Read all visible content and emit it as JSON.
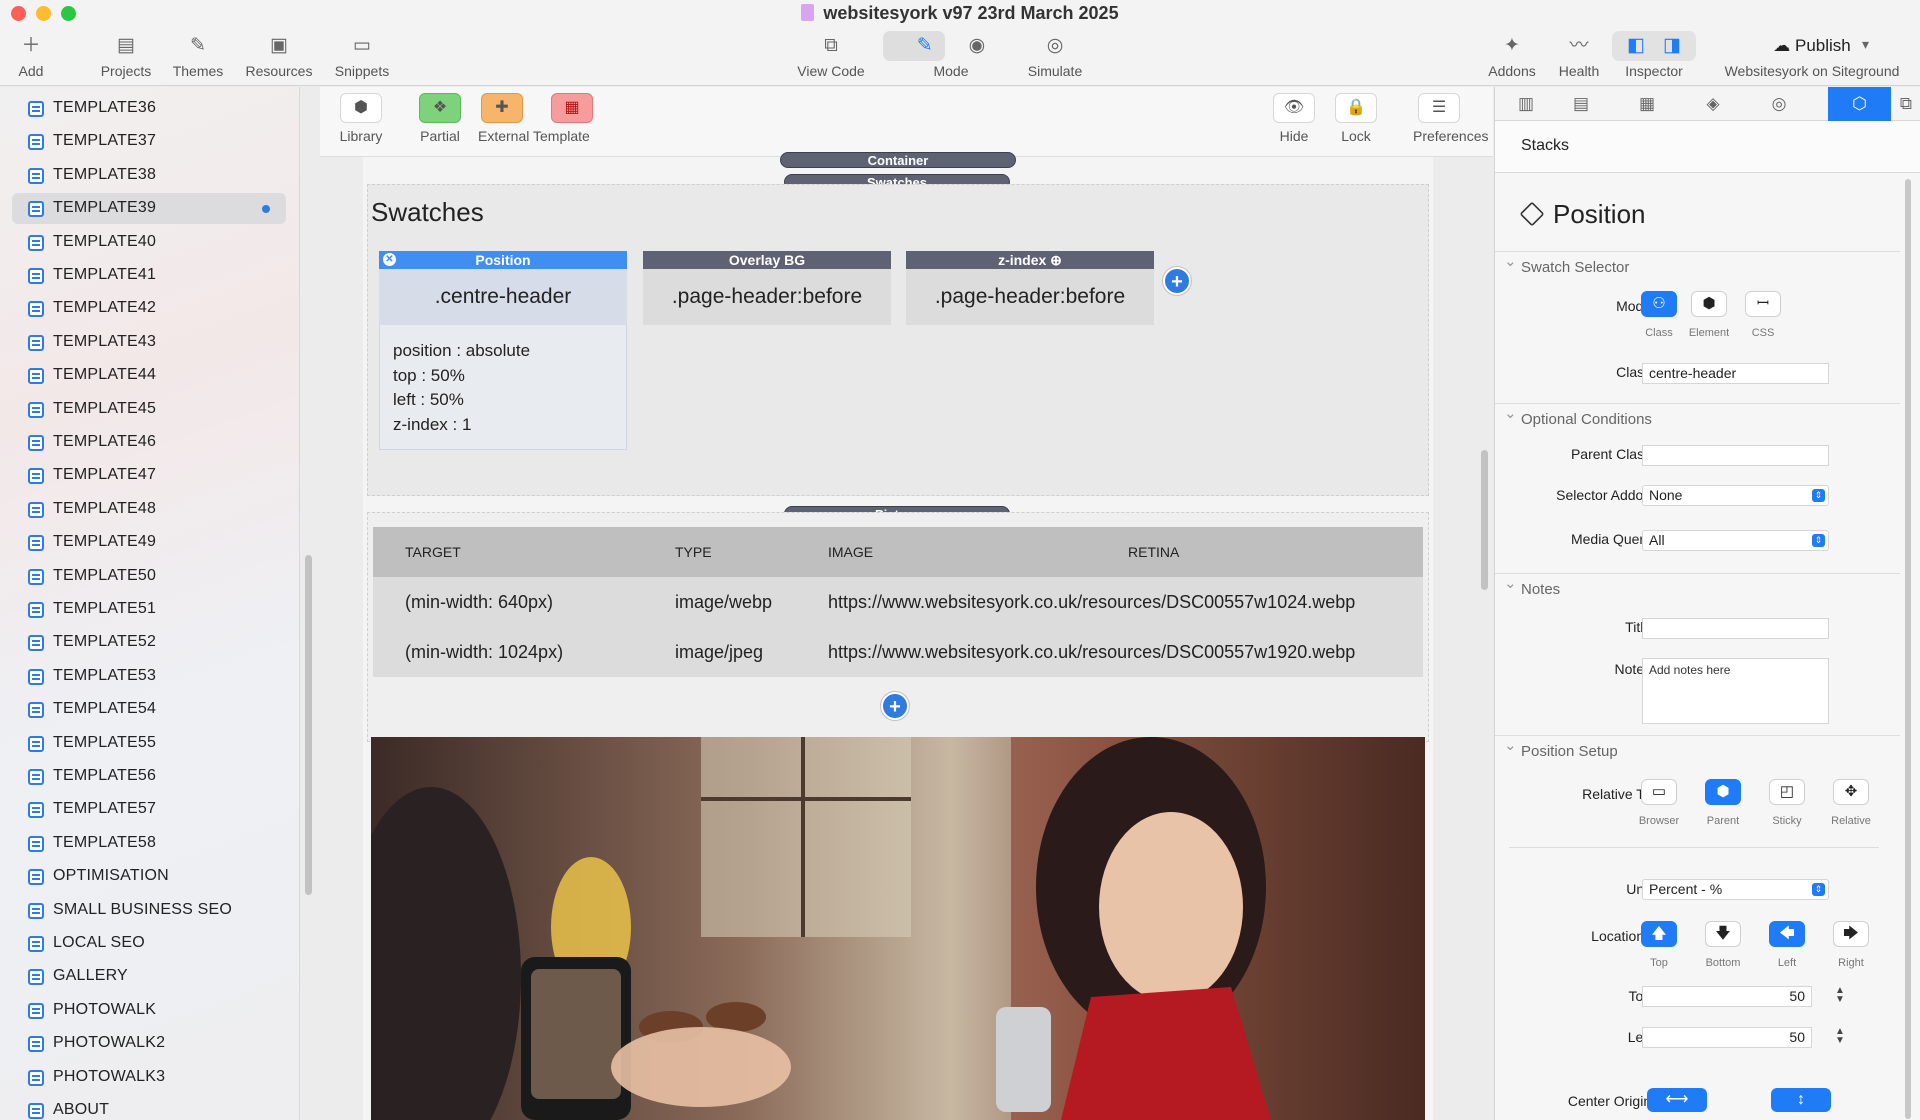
{
  "window": {
    "title": "websitesyork v97 23rd March 2025"
  },
  "toolbar": {
    "add": "Add",
    "projects": "Projects",
    "themes": "Themes",
    "resources": "Resources",
    "snippets": "Snippets",
    "view_code": "View Code",
    "mode": "Mode",
    "simulate": "Simulate",
    "addons": "Addons",
    "health": "Health",
    "inspector": "Inspector",
    "publish": "Publish",
    "publish_target": "Websitesyork on Siteground"
  },
  "sidebar": {
    "items": [
      "TEMPLATE36",
      "TEMPLATE37",
      "TEMPLATE38",
      "TEMPLATE39",
      "TEMPLATE40",
      "TEMPLATE41",
      "TEMPLATE42",
      "TEMPLATE43",
      "TEMPLATE44",
      "TEMPLATE45",
      "TEMPLATE46",
      "TEMPLATE47",
      "TEMPLATE48",
      "TEMPLATE49",
      "TEMPLATE50",
      "TEMPLATE51",
      "TEMPLATE52",
      "TEMPLATE53",
      "TEMPLATE54",
      "TEMPLATE55",
      "TEMPLATE56",
      "TEMPLATE57",
      "TEMPLATE58",
      "OPTIMISATION",
      "SMALL BUSINESS SEO",
      "LOCAL SEO",
      "GALLERY",
      "PHOTOWALK",
      "PHOTOWALK2",
      "PHOTOWALK3",
      "ABOUT"
    ],
    "selected": "TEMPLATE39"
  },
  "editor_toolbar": {
    "library": "Library",
    "partial": "Partial",
    "external_template": "External Template",
    "hide": "Hide",
    "lock": "Lock",
    "preferences": "Preferences"
  },
  "canvas": {
    "container_label": "Container",
    "swatches_label": "Swatches",
    "swatches_title": "Swatches",
    "swatches": [
      {
        "header": "Position",
        "selector": ".centre-header",
        "props": [
          "position : absolute",
          "top : 50%",
          "left : 50%",
          "z-index : 1"
        ]
      },
      {
        "header": "Overlay BG",
        "selector": ".page-header:before"
      },
      {
        "header": "z-index ⊕",
        "selector": ".page-header:before"
      }
    ],
    "picture_label": "Picture",
    "picture_table": {
      "headers": [
        "TARGET",
        "TYPE",
        "IMAGE",
        "RETINA"
      ],
      "rows": [
        [
          "(min-width: 640px)",
          "image/webp",
          "https://www.websitesyork.co.uk/resources/DSC00557w1024.webp"
        ],
        [
          "(min-width: 1024px)",
          "image/jpeg",
          "https://www.websitesyork.co.uk/resources/DSC00557w1920.webp"
        ]
      ]
    }
  },
  "inspector": {
    "header": "Stacks",
    "title": "Position",
    "swatch_selector": {
      "section": "Swatch Selector",
      "mode_label": "Mode:",
      "modes": [
        "Class",
        "Element",
        "CSS"
      ],
      "class_label": "Class:",
      "class_value": "centre-header"
    },
    "optional_conditions": {
      "section": "Optional Conditions",
      "parent_class_label": "Parent Class:",
      "selector_addon_label": "Selector Addon:",
      "selector_addon_value": "None",
      "media_query_label": "Media Query:",
      "media_query_value": "All"
    },
    "notes": {
      "section": "Notes",
      "title_label": "Title:",
      "notes_label": "Notes:",
      "notes_placeholder": "Add notes here"
    },
    "position_setup": {
      "section": "Position Setup",
      "relative_label": "Relative To:",
      "relative_options": [
        "Browser",
        "Parent",
        "Sticky",
        "Relative"
      ],
      "unit_label": "Unit:",
      "unit_value": "Percent - %",
      "locations_label": "Locations:",
      "locations": [
        "Top",
        "Bottom",
        "Left",
        "Right"
      ],
      "top_label": "Top:",
      "top_value": "50",
      "left_label": "Left:",
      "left_value": "50",
      "center_origin_label": "Center Origin:"
    }
  }
}
